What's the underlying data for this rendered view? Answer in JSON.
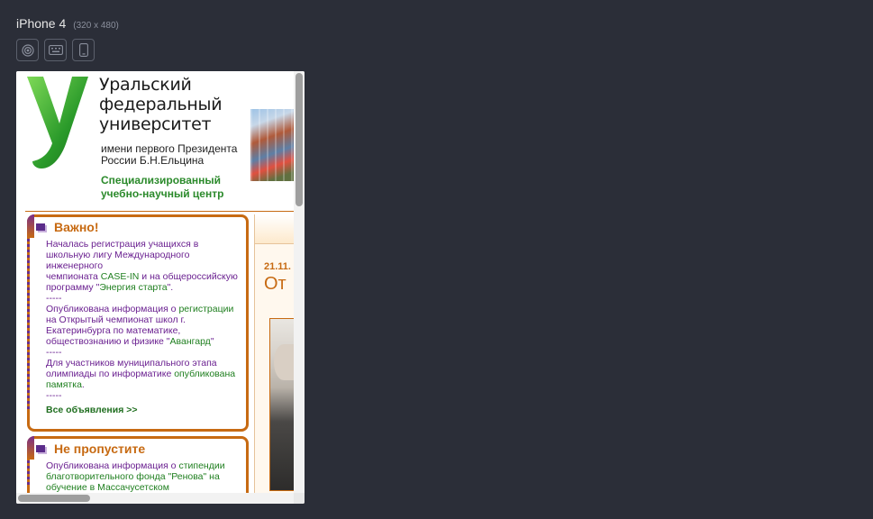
{
  "device": {
    "name": "iPhone 4",
    "size": "(320 x 480)"
  },
  "toolbar": [
    {
      "icon": "touch-icon"
    },
    {
      "icon": "keyboard-icon"
    },
    {
      "icon": "phone-rotate-icon"
    }
  ],
  "site": {
    "name_lines": [
      "Уральский",
      "федеральный",
      "университет"
    ],
    "subtitle_lines": [
      "имени первого Президента",
      "России Б.Н.Ельцина"
    ],
    "center_lines": [
      "Специализированный",
      "учебно-научный центр"
    ],
    "colors": {
      "accent": "#c76a12",
      "purple": "#6a2090",
      "green": "#2b8a2b"
    }
  },
  "important": {
    "title": "Важно!",
    "item1": {
      "a": "Началась регистрация учащихся в школьную лигу Международного инженерного",
      "b": "чемпионата ",
      "c": "CASE-IN",
      "d": " и на общероссийскую программу \"",
      "e": "Энергия старта",
      "f": "\"."
    },
    "sep1": "-----",
    "item2": {
      "a": "Опубликована информация о ",
      "b": "регистрации",
      "c": " на Открытый чемпионат школ г. Екатеринбурга по математике, обществознанию и физике \"",
      "d": "Авангард",
      "e": "\""
    },
    "sep2": "-----",
    "item3": {
      "a": "Для участников муниципального этапа олимпиады по информатике ",
      "b": "опубликована памятка",
      "c": "."
    },
    "sep3": "-----",
    "all_link": "Все объявления >>"
  },
  "dont_miss": {
    "title": "Не пропустите",
    "item1": {
      "a": "Опубликована информация о ",
      "b": "стипендии благотворительного фонда \"Ренова\" на обучение в Массачусетском"
    }
  },
  "news": {
    "date": "21.11.",
    "title": "От"
  }
}
